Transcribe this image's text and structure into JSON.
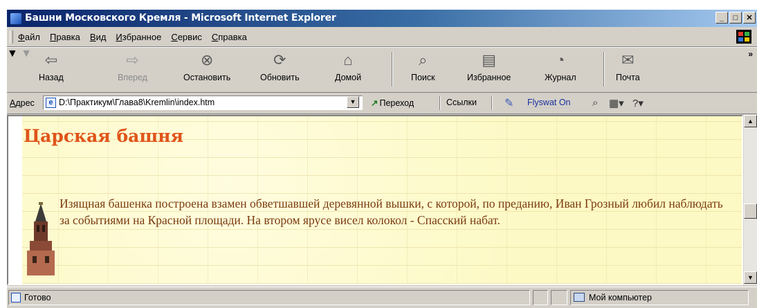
{
  "window": {
    "title": "Башни Московского Кремля - Microsoft Internet Explorer"
  },
  "menu": [
    "Файл",
    "Правка",
    "Вид",
    "Избранное",
    "Сервис",
    "Справка"
  ],
  "toolbar": {
    "back": "Назад",
    "forward": "Вперед",
    "stop": "Остановить",
    "refresh": "Обновить",
    "home": "Домой",
    "search": "Поиск",
    "favorites": "Избранное",
    "history": "Журнал",
    "mail": "Почта"
  },
  "address": {
    "label": "Адрес",
    "url": "D:\\Практикум\\Глава8\\Kremlin\\index.htm",
    "go": "Переход",
    "links": "Ссылки",
    "flyswat": "Flyswat On"
  },
  "page": {
    "heading": "Царская башня",
    "text": "Изящная башенка построена взамен обветшавшей деревянной вышки, с которой, по преданию, Иван Грозный любил наблюдать за событиями на Красной площади. На втором ярусе висел колокол - Спасский набат."
  },
  "status": {
    "text": "Готово",
    "zone": "Мой компьютер"
  },
  "colors": {
    "title_start": "#0a246a",
    "heading": "#e0541a",
    "body_text": "#7a3b10",
    "page_bg": "#fdf9c4"
  }
}
